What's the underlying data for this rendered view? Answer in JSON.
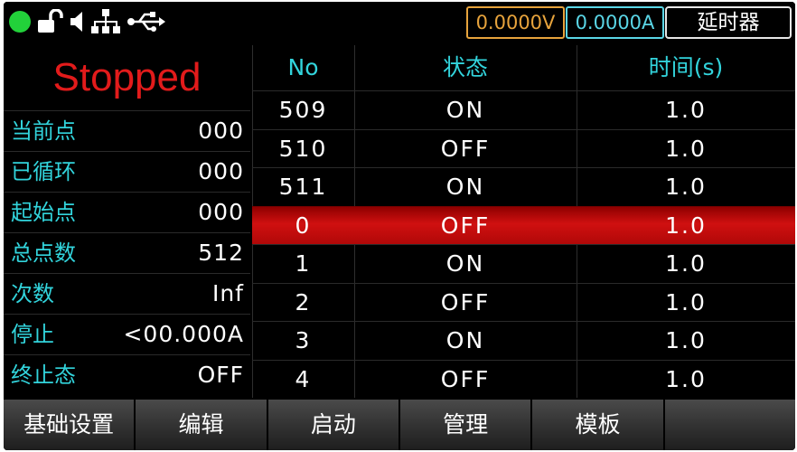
{
  "statusbar": {
    "icons": [
      "run-indicator-icon",
      "unlock-icon",
      "speaker-icon",
      "network-icon",
      "usb-icon"
    ],
    "voltage": "0.0000V",
    "current": "0.0000A",
    "mode": "延时器"
  },
  "left_panel": {
    "state": "Stopped",
    "rows": [
      {
        "label": "当前点",
        "value": "000"
      },
      {
        "label": "已循环",
        "value": "000"
      },
      {
        "label": "起始点",
        "value": "000"
      },
      {
        "label": "总点数",
        "value": "512"
      },
      {
        "label": "次数",
        "value": "Inf"
      },
      {
        "label": "停止",
        "value": "<00.000A"
      },
      {
        "label": "终止态",
        "value": "OFF"
      }
    ]
  },
  "table": {
    "headers": [
      "No",
      "状态",
      "时间(s)"
    ],
    "selected_row": 3,
    "rows": [
      [
        "509",
        "ON",
        "1.0"
      ],
      [
        "510",
        "OFF",
        "1.0"
      ],
      [
        "511",
        "ON",
        "1.0"
      ],
      [
        "0",
        "OFF",
        "1.0"
      ],
      [
        "1",
        "ON",
        "1.0"
      ],
      [
        "2",
        "OFF",
        "1.0"
      ],
      [
        "3",
        "ON",
        "1.0"
      ],
      [
        "4",
        "OFF",
        "1.0"
      ]
    ]
  },
  "softkeys": [
    "基础设置",
    "编辑",
    "启动",
    "管理",
    "模板",
    ""
  ],
  "colors": {
    "accent_cyan": "#32d4dc",
    "stopped_red": "#e21b1b",
    "voltage_orange": "#e7a33c",
    "run_green": "#22d13a",
    "selected_row_red": "#c00c0c"
  }
}
